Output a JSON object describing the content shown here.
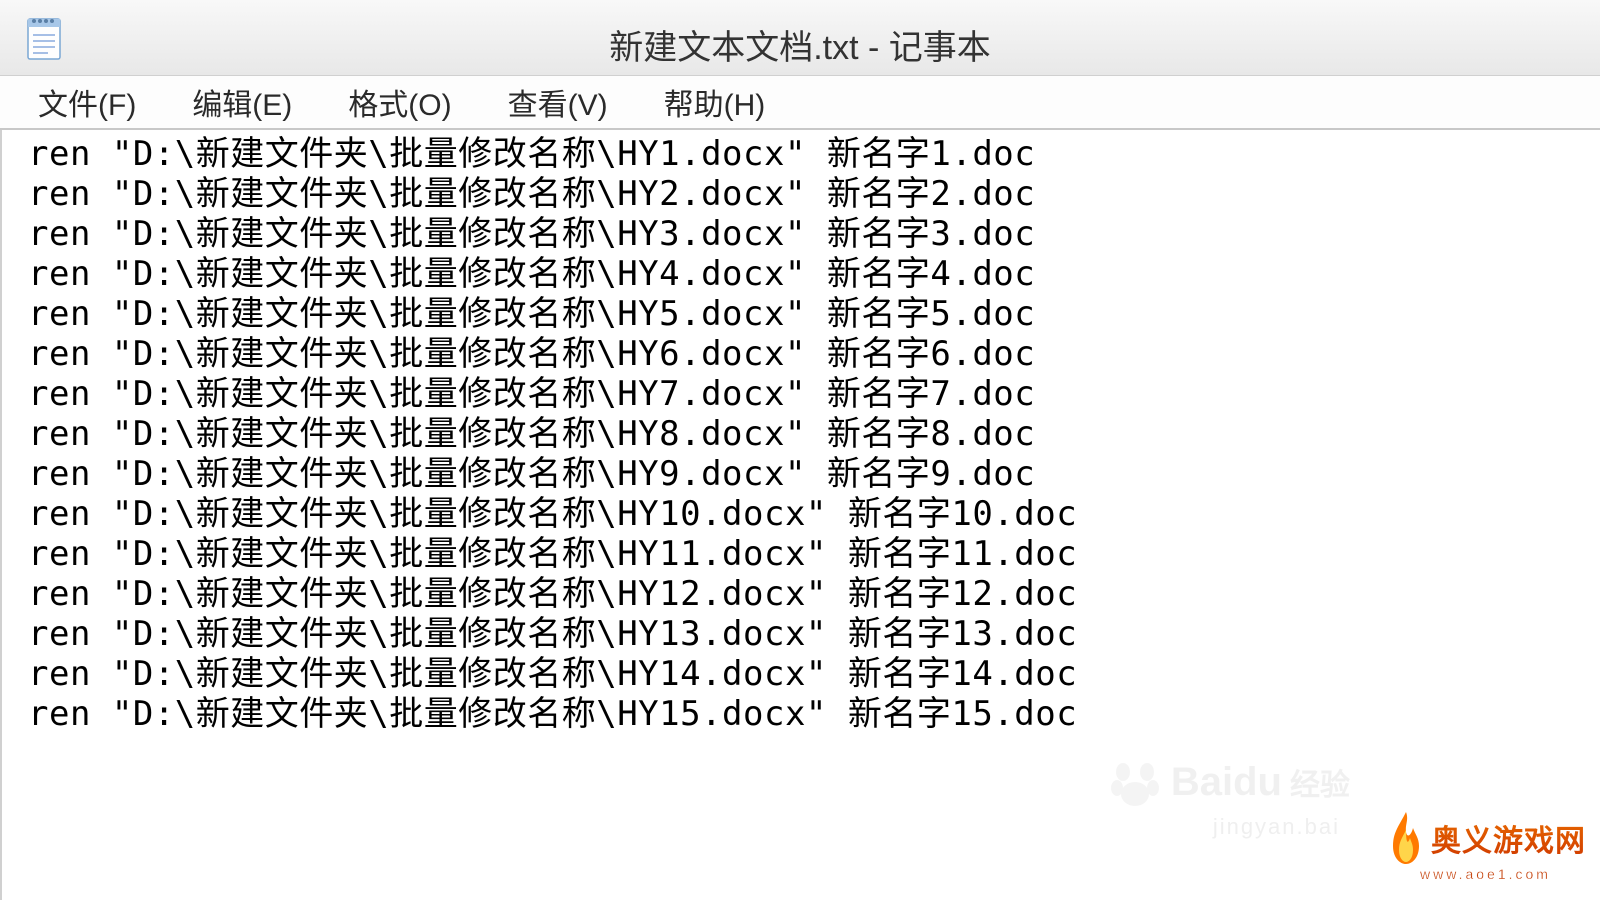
{
  "titlebar": {
    "title": "新建文本文档.txt - 记事本"
  },
  "menubar": {
    "file": "文件(F)",
    "edit": "编辑(E)",
    "format": "格式(O)",
    "view": "查看(V)",
    "help": "帮助(H)"
  },
  "editor": {
    "lines": [
      "ren \"D:\\新建文件夹\\批量修改名称\\HY1.docx\" 新名字1.doc",
      "ren \"D:\\新建文件夹\\批量修改名称\\HY2.docx\" 新名字2.doc",
      "ren \"D:\\新建文件夹\\批量修改名称\\HY3.docx\" 新名字3.doc",
      "ren \"D:\\新建文件夹\\批量修改名称\\HY4.docx\" 新名字4.doc",
      "ren \"D:\\新建文件夹\\批量修改名称\\HY5.docx\" 新名字5.doc",
      "ren \"D:\\新建文件夹\\批量修改名称\\HY6.docx\" 新名字6.doc",
      "ren \"D:\\新建文件夹\\批量修改名称\\HY7.docx\" 新名字7.doc",
      "ren \"D:\\新建文件夹\\批量修改名称\\HY8.docx\" 新名字8.doc",
      "ren \"D:\\新建文件夹\\批量修改名称\\HY9.docx\" 新名字9.doc",
      "ren \"D:\\新建文件夹\\批量修改名称\\HY10.docx\" 新名字10.doc",
      "ren \"D:\\新建文件夹\\批量修改名称\\HY11.docx\" 新名字11.doc",
      "ren \"D:\\新建文件夹\\批量修改名称\\HY12.docx\" 新名字12.doc",
      "ren \"D:\\新建文件夹\\批量修改名称\\HY13.docx\" 新名字13.doc",
      "ren \"D:\\新建文件夹\\批量修改名称\\HY14.docx\" 新名字14.doc",
      "ren \"D:\\新建文件夹\\批量修改名称\\HY15.docx\" 新名字15.doc"
    ]
  },
  "watermark1": {
    "brand": "Baidu",
    "suffix": "经验",
    "url": "jingyan.bai"
  },
  "watermark2": {
    "brand": "奥义游戏网",
    "url": "www.aoe1.com"
  }
}
